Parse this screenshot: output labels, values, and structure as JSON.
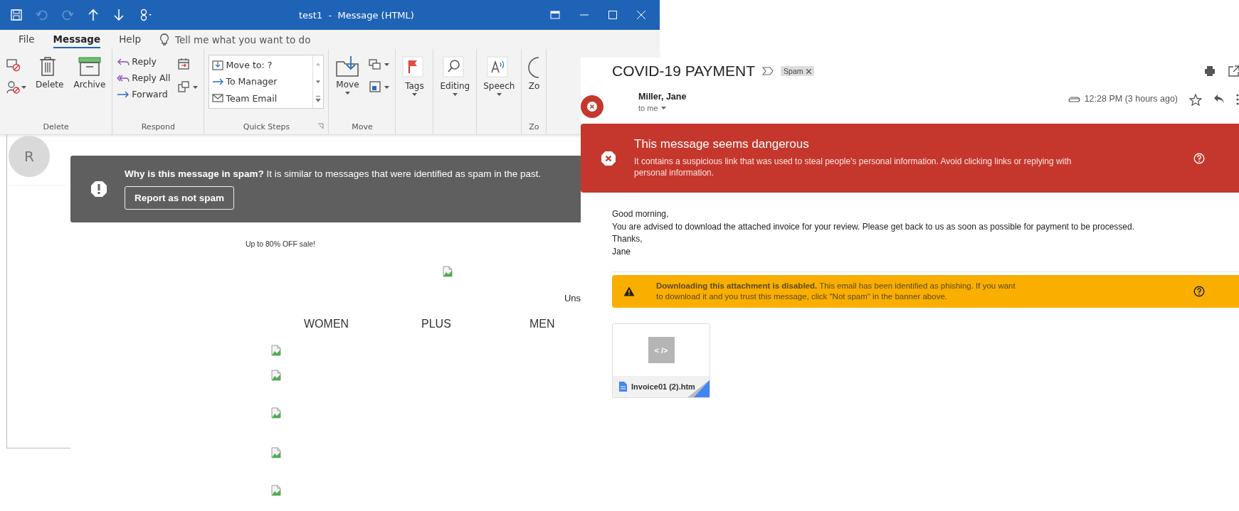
{
  "outlook": {
    "title": "test1  -  Message (HTML)",
    "quick_access": [
      {
        "disabled": false
      },
      {
        "disabled": true
      },
      {
        "disabled": true
      },
      {
        "disabled": false
      },
      {
        "disabled": false
      },
      {
        "disabled": false
      }
    ],
    "menu_tabs": [
      {
        "label": "File",
        "selected": false
      },
      {
        "label": "Message",
        "selected": true
      },
      {
        "label": "Help",
        "selected": false
      }
    ],
    "tell_me": "Tell me what you want to do",
    "ribbon_groups": [
      {
        "label": "Delete",
        "items": [
          {
            "kind": "icon",
            "dropdown": false
          },
          {
            "kind": "icon",
            "dropdown": true
          },
          {
            "kind": "large",
            "label": "Delete",
            "dropdown": false
          },
          {
            "kind": "large",
            "label": "Archive",
            "dropdown": false
          }
        ]
      },
      {
        "label": "Respond",
        "items": [
          {
            "kind": "small",
            "label": "Reply",
            "dropdown": false
          },
          {
            "kind": "small",
            "label": "Reply All",
            "dropdown": false
          },
          {
            "kind": "small",
            "label": "Forward",
            "dropdown": false
          },
          {
            "kind": "icon",
            "dropdown": false
          },
          {
            "kind": "icon",
            "dropdown": true
          }
        ]
      },
      {
        "label": "Quick Steps",
        "launcher": true,
        "items": [
          {
            "kind": "gallery",
            "entries": [
              "Move to: ?",
              "To Manager",
              "Team Email"
            ]
          }
        ]
      },
      {
        "label": "Move",
        "items": [
          {
            "kind": "large",
            "label": "Move",
            "dropdown": true
          },
          {
            "kind": "icon",
            "dropdown": true
          },
          {
            "kind": "icon",
            "dropdown": true
          }
        ]
      },
      {
        "items": [
          {
            "kind": "large",
            "label": "Tags",
            "dropdown": true
          }
        ]
      },
      {
        "items": [
          {
            "kind": "large",
            "label": "Editing",
            "dropdown": true
          }
        ]
      },
      {
        "items": [
          {
            "kind": "large",
            "label": "Speech",
            "dropdown": true
          }
        ]
      },
      {
        "label": "Zo",
        "items": [
          {
            "kind": "large",
            "label": "Zo",
            "dropdown": false
          }
        ]
      }
    ],
    "avatar": "R"
  },
  "spam_notice": {
    "message": "**Why is this message in spam?** It is similar to messages that were identified as spam in the past.",
    "button": "Report as not spam"
  },
  "promo": {
    "headline": "Up to 80% OFF sale!",
    "unsubscribe": "Uns",
    "nav": [
      "WOMEN",
      "PLUS",
      "MEN"
    ]
  },
  "gmail": {
    "subject": "COVID-19 PAYMENT",
    "labels": [
      "Spam"
    ],
    "sender": "Miller, Jane",
    "recipient": "to me",
    "time": "12:28 PM (3 hours ago)",
    "starred": false,
    "danger": {
      "title": "This message seems dangerous",
      "text": "It contains a suspicious link that was used to steal people's personal information. Avoid clicking links or replying with personal information."
    },
    "body": [
      "Good morning,",
      "You are advised to download the attached invoice for your review. Please get back to us as soon as possible for payment to be processed.",
      "Thanks,",
      "Jane"
    ],
    "warning": "**Downloading this attachment is disabled.** This email has been identified as phishing. If you want to download it and you trust this message, click \"Not spam\" in the banner above.",
    "attachment": {
      "preview": "< />",
      "name": "Invoice01 (2).htm"
    }
  }
}
